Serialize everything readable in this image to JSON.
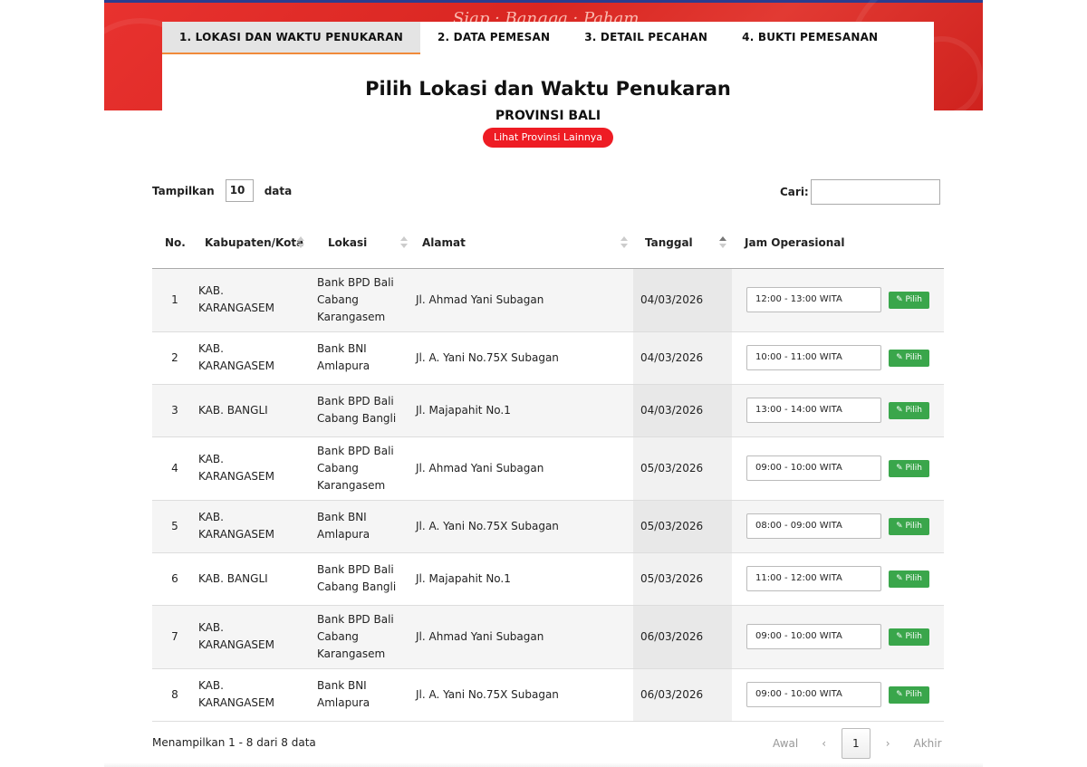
{
  "hero": {
    "tagline": "Siap · Bangga · Paham"
  },
  "tabs": [
    {
      "label": "1. LOKASI DAN WAKTU PENUKARAN",
      "active": true
    },
    {
      "label": "2. DATA PEMESAN",
      "active": false
    },
    {
      "label": "3. DETAIL PECAHAN",
      "active": false
    },
    {
      "label": "4. BUKTI PEMESANAN",
      "active": false
    }
  ],
  "heading": {
    "title": "Pilih Lokasi dan Waktu Penukaran",
    "province": "PROVINSI BALI",
    "other_province_button": "Lihat Provinsi Lainnya"
  },
  "controls": {
    "show_label": "Tampilkan",
    "show_value": "10",
    "show_suffix": "data",
    "search_label": "Cari:"
  },
  "table": {
    "headers": {
      "no": "No.",
      "kabupaten": "Kabupaten/Kota",
      "lokasi": "Lokasi",
      "alamat": "Alamat",
      "tanggal": "Tanggal",
      "jam": "Jam Operasional"
    },
    "button_label": "Pilih",
    "rows": [
      {
        "no": "1",
        "kab": "KAB. KARANGASEM",
        "lokasi": "Bank BPD Bali Cabang Karangasem",
        "alamat": "Jl. Ahmad Yani Subagan",
        "tanggal": "04/03/2026",
        "jam": "12:00 - 13:00 WITA"
      },
      {
        "no": "2",
        "kab": "KAB. KARANGASEM",
        "lokasi": "Bank BNI Amlapura",
        "alamat": "Jl. A. Yani No.75X Subagan",
        "tanggal": "04/03/2026",
        "jam": "10:00 - 11:00 WITA"
      },
      {
        "no": "3",
        "kab": "KAB. BANGLI",
        "lokasi": "Bank BPD Bali Cabang Bangli",
        "alamat": "Jl. Majapahit No.1",
        "tanggal": "04/03/2026",
        "jam": "13:00 - 14:00 WITA"
      },
      {
        "no": "4",
        "kab": "KAB. KARANGASEM",
        "lokasi": "Bank BPD Bali Cabang Karangasem",
        "alamat": "Jl. Ahmad Yani Subagan",
        "tanggal": "05/03/2026",
        "jam": "09:00 - 10:00 WITA"
      },
      {
        "no": "5",
        "kab": "KAB. KARANGASEM",
        "lokasi": "Bank BNI Amlapura",
        "alamat": "Jl. A. Yani No.75X Subagan",
        "tanggal": "05/03/2026",
        "jam": "08:00 - 09:00 WITA"
      },
      {
        "no": "6",
        "kab": "KAB. BANGLI",
        "lokasi": "Bank BPD Bali Cabang Bangli",
        "alamat": "Jl. Majapahit No.1",
        "tanggal": "05/03/2026",
        "jam": "11:00 - 12:00 WITA"
      },
      {
        "no": "7",
        "kab": "KAB. KARANGASEM",
        "lokasi": "Bank BPD Bali Cabang Karangasem",
        "alamat": "Jl. Ahmad Yani Subagan",
        "tanggal": "06/03/2026",
        "jam": "09:00 - 10:00 WITA"
      },
      {
        "no": "8",
        "kab": "KAB. KARANGASEM",
        "lokasi": "Bank BNI Amlapura",
        "alamat": "Jl. A. Yani No.75X Subagan",
        "tanggal": "06/03/2026",
        "jam": "09:00 - 10:00 WITA"
      }
    ]
  },
  "footer": {
    "info": "Menampilkan 1 - 8 dari 8 data",
    "pager": {
      "first": "Awal",
      "prev": "‹",
      "current": "1",
      "next": "›",
      "last": "Akhir"
    }
  }
}
